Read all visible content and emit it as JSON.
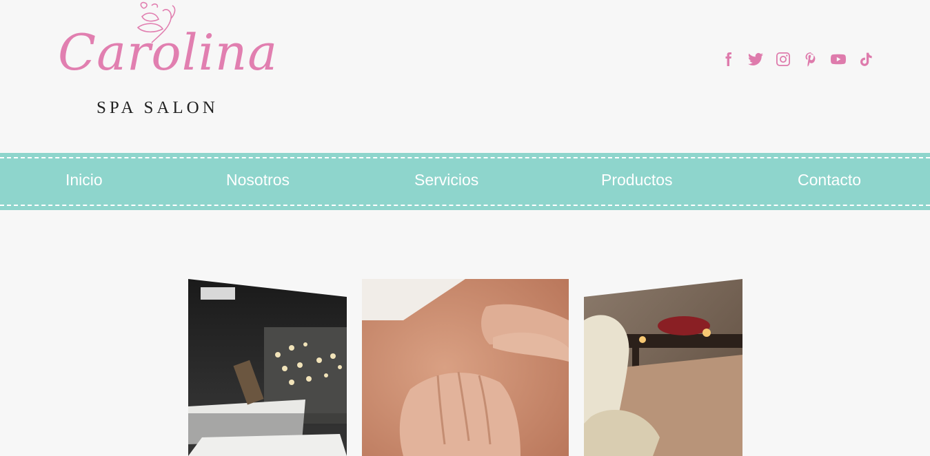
{
  "brand": {
    "name": "Carolina",
    "tagline": "SPA SALON",
    "color_pink": "#e17fb0"
  },
  "social": [
    {
      "icon": "facebook-icon"
    },
    {
      "icon": "twitter-icon"
    },
    {
      "icon": "instagram-icon"
    },
    {
      "icon": "pinterest-icon"
    },
    {
      "icon": "youtube-icon"
    },
    {
      "icon": "tiktok-icon"
    }
  ],
  "nav": {
    "background": "#8ed5cc",
    "items": [
      {
        "label": "Inicio"
      },
      {
        "label": "Nosotros"
      },
      {
        "label": "Servicios"
      },
      {
        "label": "Productos"
      },
      {
        "label": "Contacto"
      }
    ]
  },
  "gallery": [
    {
      "name": "spa-room-photo"
    },
    {
      "name": "massage-photo"
    },
    {
      "name": "towel-swan-photo"
    }
  ]
}
